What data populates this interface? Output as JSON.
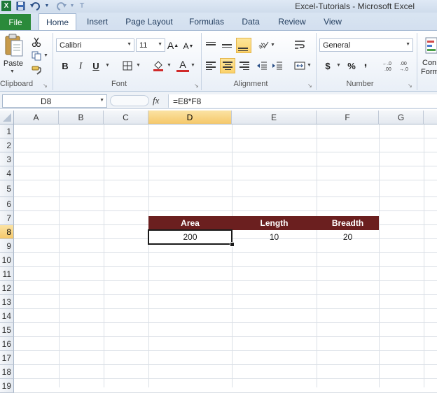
{
  "window": {
    "title": "Excel-Tutorials  -  Microsoft Excel"
  },
  "quick_access": {
    "save_icon": "save-icon",
    "undo_icon": "undo-icon",
    "redo_icon": "redo-icon",
    "customize_icon": "customize-icon"
  },
  "tabs": [
    {
      "label": "File"
    },
    {
      "label": "Home"
    },
    {
      "label": "Insert"
    },
    {
      "label": "Page Layout"
    },
    {
      "label": "Formulas"
    },
    {
      "label": "Data"
    },
    {
      "label": "Review"
    },
    {
      "label": "View"
    }
  ],
  "ribbon": {
    "clipboard": {
      "label": "Clipboard",
      "paste": "Paste"
    },
    "font": {
      "label": "Font",
      "name": "Calibri",
      "size": "11",
      "bold": "B",
      "italic": "I",
      "underline": "U",
      "grow": "A",
      "shrink": "A",
      "color_a": "A"
    },
    "alignment": {
      "label": "Alignment"
    },
    "number": {
      "label": "Number",
      "format": "General",
      "currency": "$",
      "percent": "%",
      "comma": ",",
      "inc_dec": ".0→.00",
      "dec_dec": ".00→.0"
    },
    "styles": {
      "cond_format": "Con",
      "format": "Form"
    }
  },
  "formula_bar": {
    "name_box": "D8",
    "fx": "fx",
    "formula": "=E8*F8"
  },
  "grid": {
    "columns": [
      "A",
      "B",
      "C",
      "D",
      "E",
      "F",
      "G"
    ],
    "rows": [
      "1",
      "2",
      "3",
      "4",
      "5",
      "6",
      "7",
      "8",
      "9",
      "10",
      "11",
      "12",
      "13",
      "14",
      "15",
      "16",
      "17",
      "18",
      "19"
    ],
    "selected_column": "D",
    "selected_row": "8",
    "cells": {
      "D7": "Area",
      "E7": "Length",
      "F7": "Breadth",
      "D8": "200",
      "E8": "10",
      "F8": "20"
    }
  },
  "colors": {
    "header_fill": "#6b1f1f",
    "header_text": "#ffffff",
    "file_tab": "#2a8a3a",
    "selection": "#f5c86a"
  }
}
